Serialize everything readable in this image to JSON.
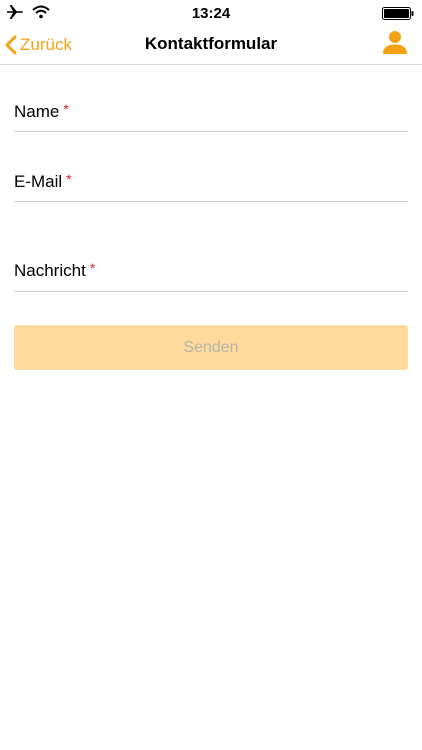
{
  "status_bar": {
    "time": "13:24",
    "icons": [
      "airplane-icon",
      "wifi-icon",
      "battery-icon"
    ]
  },
  "nav": {
    "back_label": "Zurück",
    "title": "Kontaktformular",
    "user_icon": "user-icon"
  },
  "form": {
    "fields": [
      {
        "label": "Name",
        "required_mark": "*"
      },
      {
        "label": "E-Mail",
        "required_mark": "*"
      },
      {
        "label": "Nachricht",
        "required_mark": "*"
      }
    ],
    "submit_label": "Senden"
  },
  "colors": {
    "accent": "#f5a114",
    "button_bg": "#fedb9c",
    "required": "#e31b23"
  }
}
